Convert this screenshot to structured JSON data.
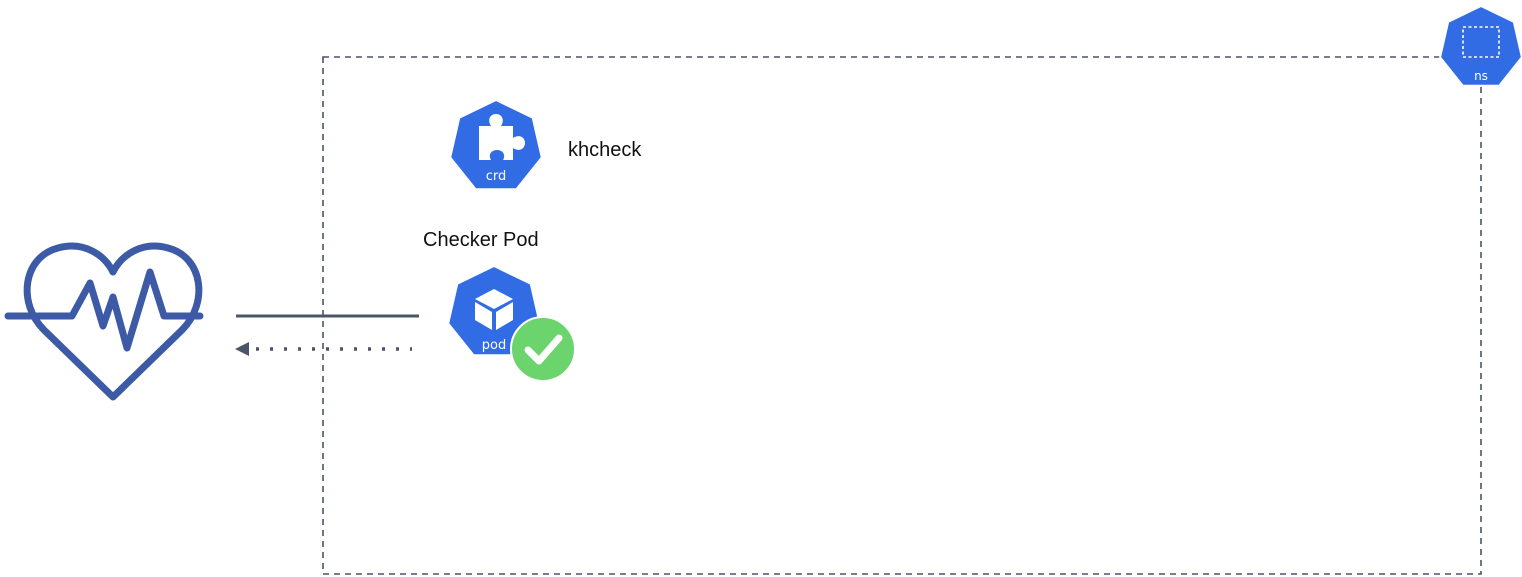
{
  "namespace": {
    "icon_label": "ns"
  },
  "crd": {
    "icon_label": "crd",
    "name": "khcheck"
  },
  "pod": {
    "icon_label": "pod",
    "title": "Checker Pod",
    "status": "healthy"
  },
  "colors": {
    "k8s_blue": "#326ce5",
    "heart_stroke": "#3c5aa6",
    "check_green": "#6cd46c",
    "arrow": "#4a5568",
    "namespace_border": "#4a5568"
  },
  "icons": {
    "heart": "heart-pulse-icon",
    "crd": "puzzle-piece-icon",
    "pod": "cube-icon",
    "status": "checkmark-icon",
    "namespace": "namespace-icon"
  }
}
